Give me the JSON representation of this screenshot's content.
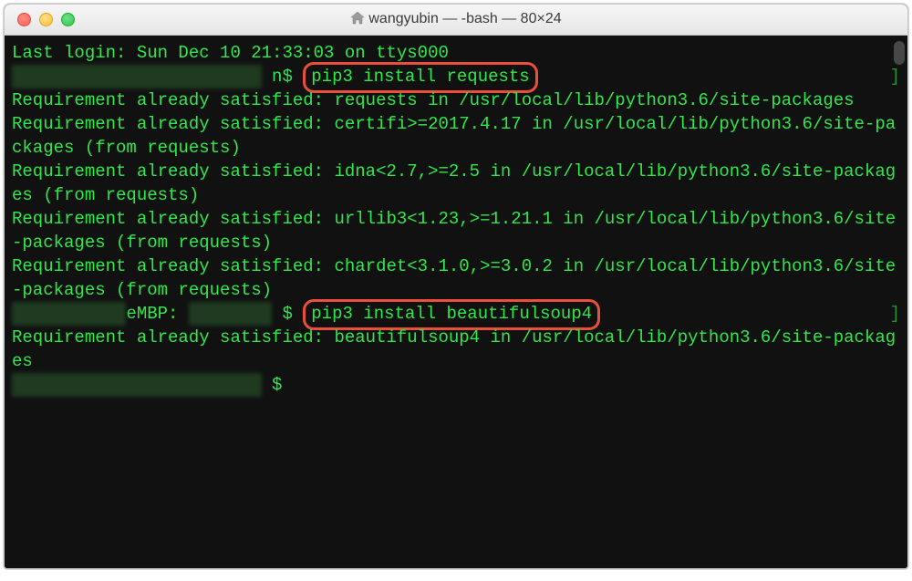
{
  "window": {
    "title": "wangyubin — -bash — 80×24"
  },
  "lines": {
    "last_login": "Last login: Sun Dec 10 21:33:03 on ttys000",
    "prompt1_suffix": " n$ ",
    "cmd1": "pip3 install requests",
    "rbracket": "]",
    "out1": "Requirement already satisfied: requests in /usr/local/lib/python3.6/site-packages",
    "out2": "Requirement already satisfied: certifi>=2017.4.17 in /usr/local/lib/python3.6/site-packages (from requests)",
    "out3": "Requirement already satisfied: idna<2.7,>=2.5 in /usr/local/lib/python3.6/site-packages (from requests)",
    "out4": "Requirement already satisfied: urllib3<1.23,>=1.21.1 in /usr/local/lib/python3.6/site-packages (from requests)",
    "out5": "Requirement already satisfied: chardet<3.1.0,>=3.0.2 in /usr/local/lib/python3.6/site-packages (from requests)",
    "prompt2_host": "eMBP:",
    "prompt2_suffix": " $ ",
    "cmd2": "pip3 install beautifulsoup4",
    "out6": "Requirement already satisfied: beautifulsoup4 in /usr/local/lib/python3.6/site-packages",
    "prompt3_suffix": " $"
  }
}
